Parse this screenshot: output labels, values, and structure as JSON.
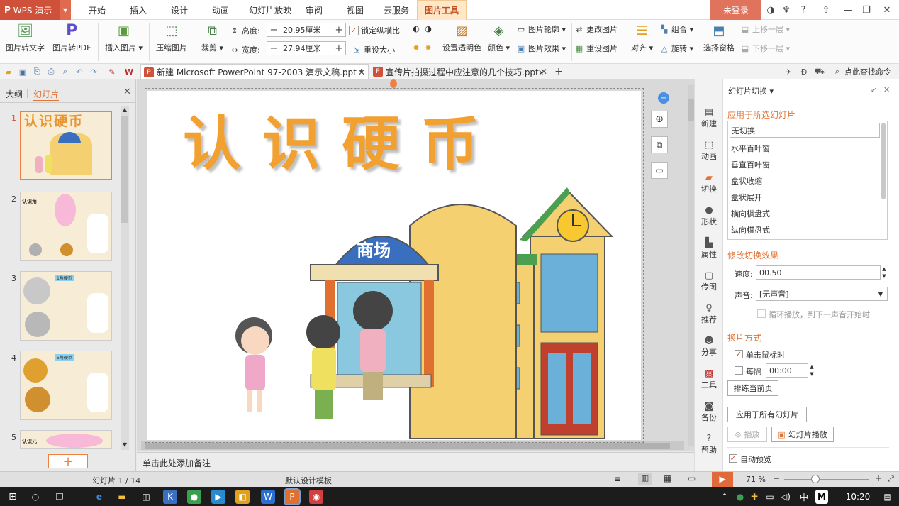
{
  "app": {
    "name": "WPS 演示",
    "login": "未登录"
  },
  "menu": {
    "tabs": [
      "开始",
      "插入",
      "设计",
      "动画",
      "幻灯片放映",
      "审阅",
      "视图",
      "云服务",
      "图片工具"
    ],
    "active": "图片工具"
  },
  "ribbon": {
    "pic_to_text": "图片转文字",
    "pic_to_pdf": "图片转PDF",
    "insert_pic": "插入图片",
    "compress_pic": "压缩图片",
    "crop": "裁剪",
    "height_label": "高度:",
    "height_value": "20.95厘米",
    "width_label": "宽度:",
    "width_value": "27.94厘米",
    "lock_ratio": "锁定纵横比",
    "reset_size": "重设大小",
    "set_transparent": "设置透明色",
    "color": "颜色",
    "pic_outline": "图片轮廓",
    "pic_effect": "图片效果",
    "change_pic": "更改图片",
    "reset_pic": "重设图片",
    "align": "对齐",
    "group": "组合",
    "rotate": "旋转",
    "select_pane": "选择窗格",
    "bring_forward": "上移一层",
    "send_backward": "下移一层"
  },
  "doctabs": [
    {
      "title": "新建 Microsoft PowerPoint 97-2003 演示文稿.ppt *"
    },
    {
      "title": "宣传片拍摄过程中应注意的几个技巧.pptx"
    }
  ],
  "search_placeholder": "点此查找命令",
  "left_panel": {
    "tab_outline": "大纲",
    "tab_slides": "幻灯片",
    "thumbs": [
      {
        "num": "1",
        "caption": "认识硬币"
      },
      {
        "num": "2",
        "caption": "认识角"
      },
      {
        "num": "3",
        "caption": "1角硬币"
      },
      {
        "num": "4",
        "caption": "5角硬币"
      },
      {
        "num": "5",
        "caption": "认识元"
      }
    ]
  },
  "slide": {
    "title": "认识硬币",
    "sign": "商场"
  },
  "notes_placeholder": "单击此处添加备注",
  "side_icons": [
    "新建",
    "动画",
    "切换",
    "形状",
    "属性",
    "传图",
    "推荐",
    "分享",
    "工具",
    "备份",
    "帮助"
  ],
  "pane": {
    "title": "幻灯片切换",
    "apply_selected": "应用于所选幻灯片",
    "transitions": [
      "无切换",
      "水平百叶窗",
      "垂直百叶窗",
      "盒状收缩",
      "盒状展开",
      "横向棋盘式",
      "纵向棋盘式"
    ],
    "modify_effect": "修改切换效果",
    "speed_label": "速度:",
    "speed_value": "00.50",
    "sound_label": "声音:",
    "sound_value": "[无声音]",
    "loop_label": "循环播放，到下一声音开始时",
    "switch_mode": "换片方式",
    "on_click": "单击鼠标时",
    "every": "每隔",
    "every_value": "00:00",
    "rehearse": "排练当前页",
    "apply_all": "应用于所有幻灯片",
    "play": "播放",
    "slideshow": "幻灯片播放",
    "auto_preview": "自动预览"
  },
  "status": {
    "slide_info": "幻灯片 1 / 14",
    "template": "默认设计模板",
    "zoom": "71 %"
  },
  "taskbar": {
    "time": "10:20",
    "ime": "中",
    "ime2": "M"
  }
}
